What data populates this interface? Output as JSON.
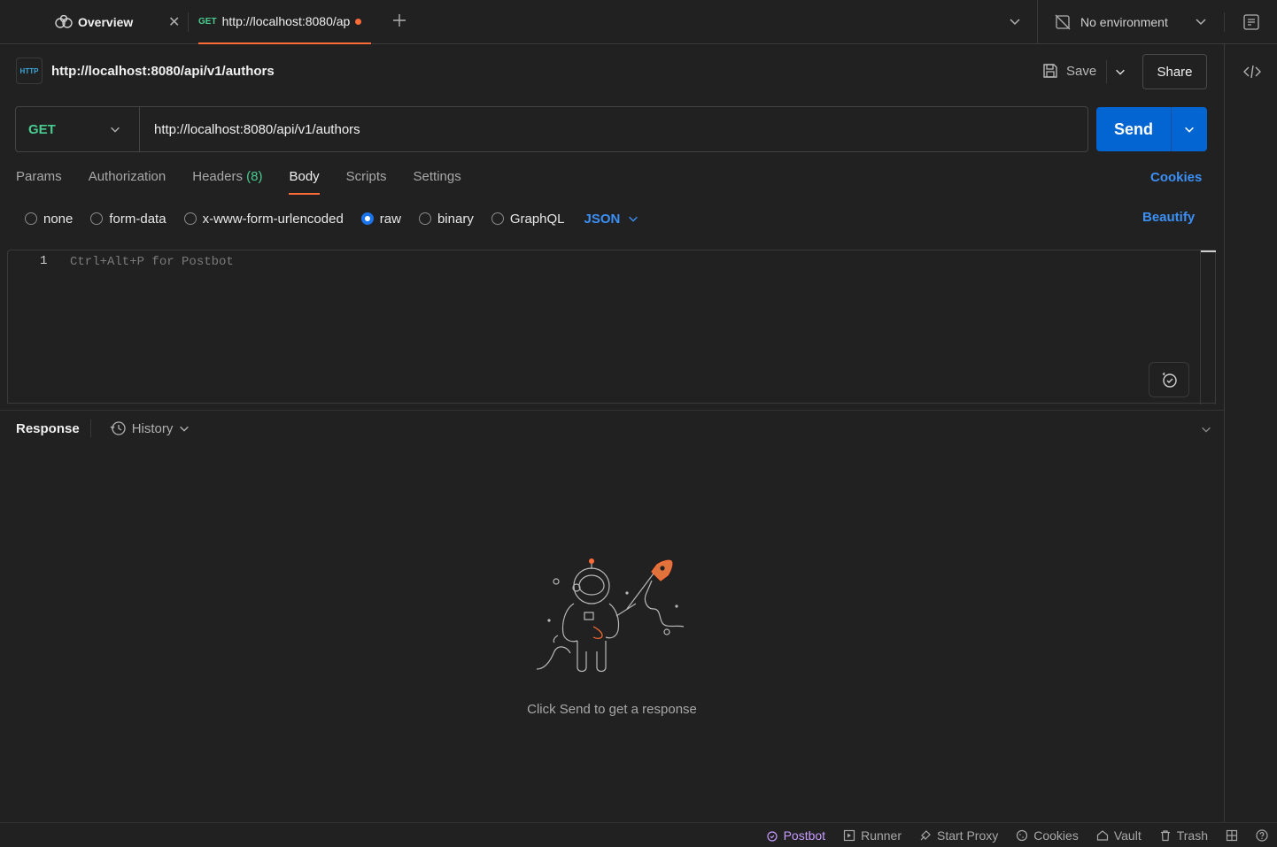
{
  "tabs": {
    "overview_label": "Overview",
    "active_method": "GET",
    "active_label": "http://localhost:8080/ap"
  },
  "environment": {
    "label": "No environment"
  },
  "request": {
    "title": "http://localhost:8080/api/v1/authors",
    "http_badge": "HTTP",
    "save_label": "Save",
    "share_label": "Share",
    "method": "GET",
    "url": "http://localhost:8080/api/v1/authors",
    "send_label": "Send"
  },
  "request_tabs": {
    "params": "Params",
    "authorization": "Authorization",
    "headers": "Headers",
    "headers_count": "(8)",
    "body": "Body",
    "scripts": "Scripts",
    "settings": "Settings",
    "cookies": "Cookies"
  },
  "body_types": {
    "none": "none",
    "form_data": "form-data",
    "urlencoded": "x-www-form-urlencoded",
    "raw": "raw",
    "binary": "binary",
    "graphql": "GraphQL",
    "format": "JSON",
    "beautify": "Beautify",
    "selected": "raw"
  },
  "editor": {
    "line_number": "1",
    "placeholder": "Ctrl+Alt+P for Postbot"
  },
  "response": {
    "title": "Response",
    "history_label": "History",
    "empty_message": "Click Send to get a response"
  },
  "statusbar": {
    "postbot": "Postbot",
    "runner": "Runner",
    "start_proxy": "Start Proxy",
    "cookies": "Cookies",
    "vault": "Vault",
    "trash": "Trash"
  },
  "colors": {
    "accent_orange": "#ff6c37",
    "send_blue": "#0265d2",
    "link_blue": "#3b8ff5",
    "get_green": "#49cc90",
    "postbot_purple": "#c89bff",
    "background": "#212121"
  }
}
